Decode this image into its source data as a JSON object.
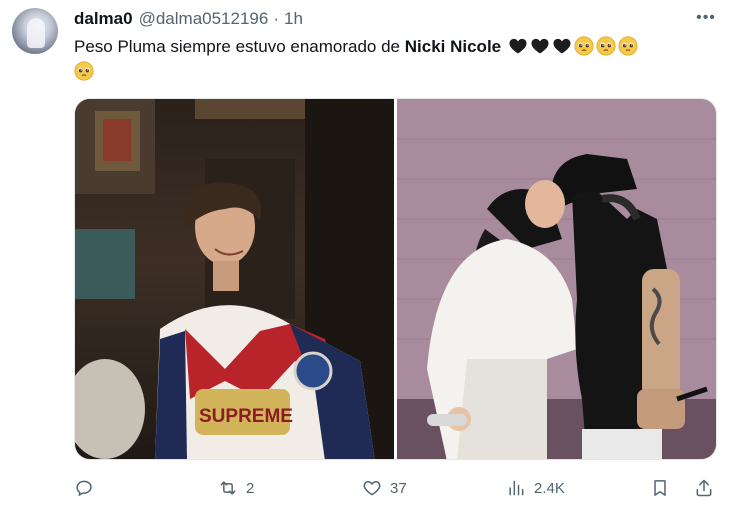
{
  "author": {
    "display_name": "dalma0",
    "handle": "@dalma0512196",
    "separator": "·",
    "time": "1h"
  },
  "menu": {
    "more_label": "•••"
  },
  "tweet": {
    "text_before": "Peso Pluma siempre estuvo enamorado de ",
    "text_bold": "Nicki Nicole",
    "emojis": [
      "black-heart",
      "black-heart",
      "black-heart",
      "pleading-face",
      "pleading-face",
      "pleading-face",
      "pleading-face"
    ]
  },
  "media": {
    "images": [
      {
        "name": "photo-left",
        "shirt_text": "SUPREME"
      },
      {
        "name": "photo-right"
      }
    ]
  },
  "actions": {
    "reply": {
      "icon": "reply-icon",
      "count": ""
    },
    "retweet": {
      "icon": "retweet-icon",
      "count": "2"
    },
    "like": {
      "icon": "heart-icon",
      "count": "37"
    },
    "views": {
      "icon": "views-icon",
      "count": "2.4K"
    },
    "bookmark": {
      "icon": "bookmark-icon",
      "count": ""
    },
    "share": {
      "icon": "share-icon",
      "count": ""
    }
  },
  "colors": {
    "text": "#0f1419",
    "secondary": "#536471",
    "border": "#e3e7ea",
    "background": "#ffffff"
  }
}
